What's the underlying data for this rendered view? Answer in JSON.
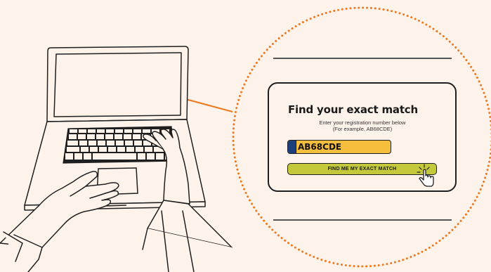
{
  "search_card": {
    "title": "Find your exact match",
    "helper_line1": "Enter your registration number below",
    "helper_line2": "(For example, AB68CDE)",
    "registration_value": "AB68CDE",
    "cta_label": "FIND ME MY EXACT MATCH"
  },
  "icons": {
    "cursor": "hand-pointer-icon",
    "illustration": "laptop-typing-hands-icon"
  },
  "colors": {
    "background": "#fdf3eb",
    "connector_orange": "#f07a22",
    "plate_yellow": "#f5be3c",
    "plate_band_blue": "#1d3f7a",
    "button_green": "#c3c93a",
    "ink": "#1f1f1f"
  }
}
